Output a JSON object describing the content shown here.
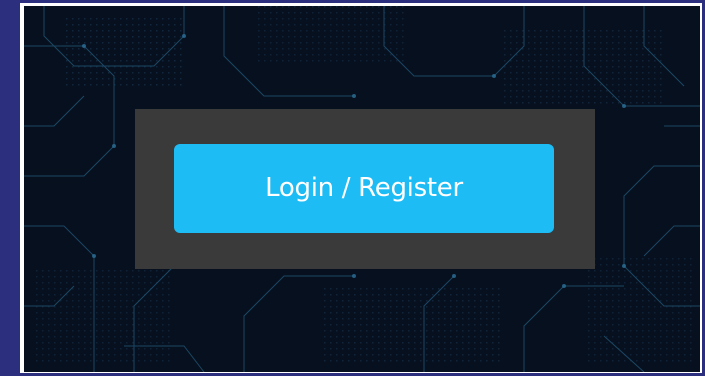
{
  "colors": {
    "outer_border": "#2b2f7e",
    "background": "#07101e",
    "circuit_lines": "#1e4d6b",
    "panel": "#3a3a3a",
    "button": "#1ebcf5",
    "button_text": "#ffffff"
  },
  "decor": {
    "background_icon": "circuit-board-pattern"
  },
  "login": {
    "button_label": "Login / Register"
  }
}
